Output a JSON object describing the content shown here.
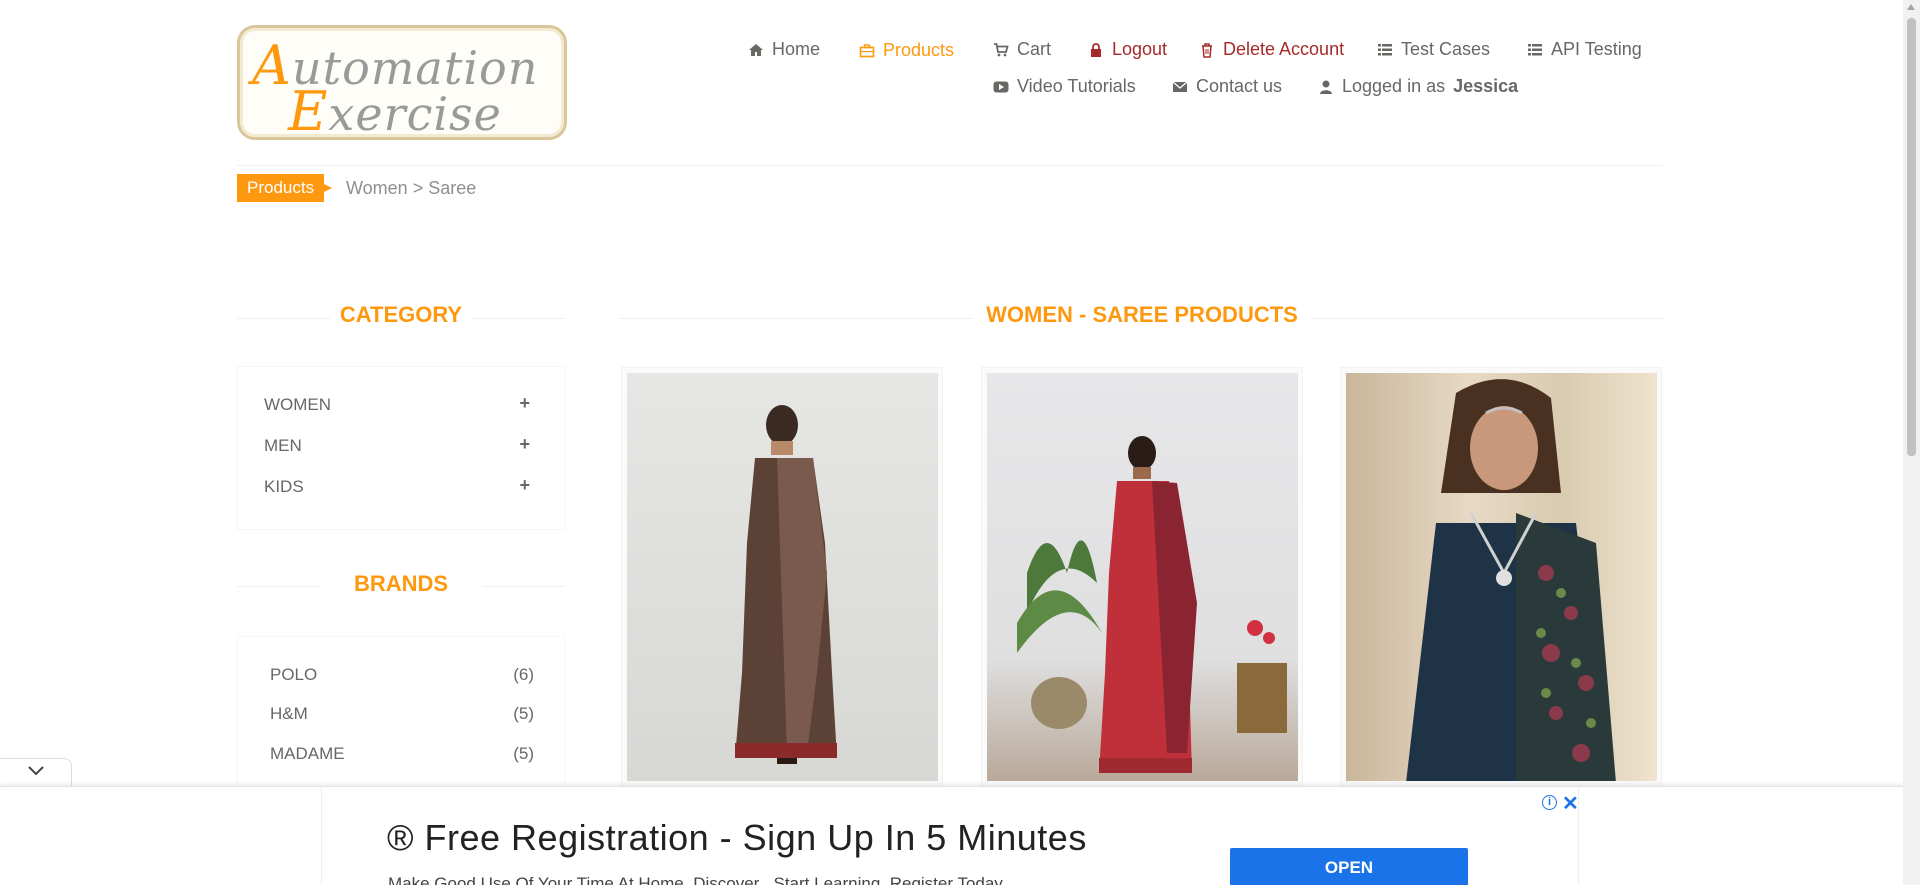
{
  "logo": {
    "line1_cap": "A",
    "line1_rest": "utomation",
    "line2_cap": "E",
    "line2_rest": "xercise"
  },
  "nav": {
    "home": "Home",
    "products": "Products",
    "cart": "Cart",
    "logout": "Logout",
    "delete_account": "Delete Account",
    "test_cases": "Test Cases",
    "api_testing": "API Testing",
    "video_tutorials": "Video Tutorials",
    "contact_us": "Contact us",
    "logged_in_prefix": "Logged in as",
    "username": "Jessica"
  },
  "breadcrumb": {
    "tag": "Products",
    "path": "Women > Saree"
  },
  "sidebar": {
    "category_title": "CATEGORY",
    "categories": [
      {
        "label": "WOMEN",
        "toggle": "+"
      },
      {
        "label": "MEN",
        "toggle": "+"
      },
      {
        "label": "KIDS",
        "toggle": "+"
      }
    ],
    "brands_title": "BRANDS",
    "brands": [
      {
        "name": "POLO",
        "count": "(6)"
      },
      {
        "name": "H&M",
        "count": "(5)"
      },
      {
        "name": "MADAME",
        "count": "(5)"
      }
    ]
  },
  "main": {
    "title": "WOMEN - SAREE PRODUCTS"
  },
  "ad": {
    "headline": "® Free Registration - Sign Up In 5 Minutes",
    "sub": "Make Good Use Of Your Time At Home. Discover , Start Learning, Register Today",
    "open_label": "OPEN",
    "info": "i",
    "close": "✕"
  },
  "colors": {
    "accent": "#fe980f",
    "danger": "#a52a2a",
    "text": "#696763",
    "ad_button": "#1a73e8"
  }
}
